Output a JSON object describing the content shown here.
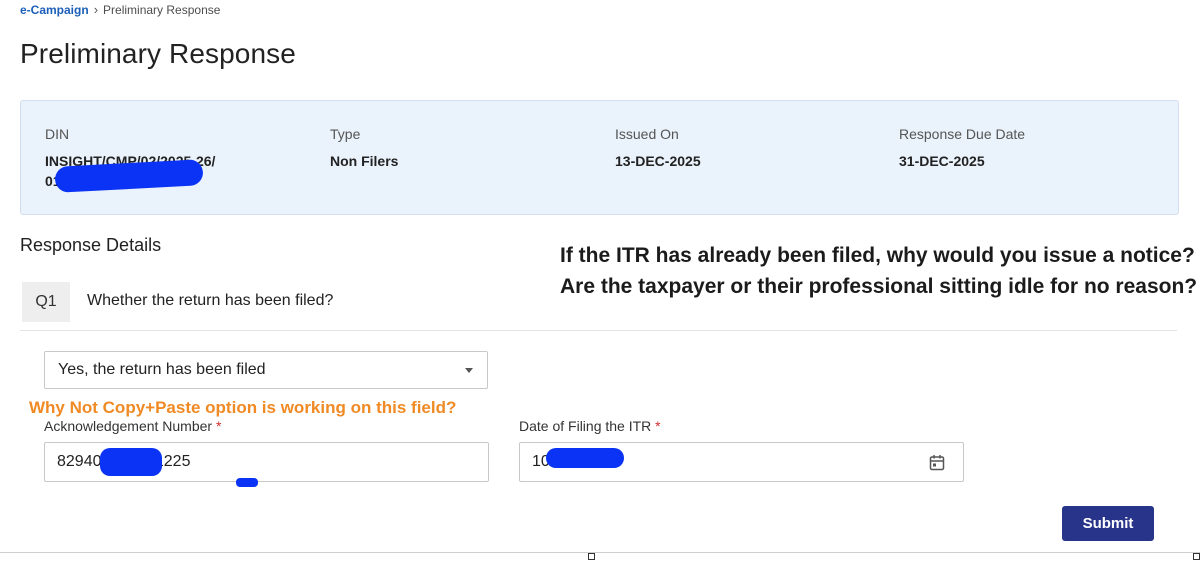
{
  "breadcrumb": {
    "parent": "e-Campaign",
    "current": "Preliminary Response"
  },
  "page_title": "Preliminary Response",
  "info": {
    "din": {
      "label": "DIN",
      "value": "INSIGHT/CMP/02/2025-26/01200001"
    },
    "type": {
      "label": "Type",
      "value": "Non Filers"
    },
    "issued_on": {
      "label": "Issued On",
      "value": "13-DEC-2025"
    },
    "due_date": {
      "label": "Response Due Date",
      "value": "31-DEC-2025"
    }
  },
  "section_title": "Response Details",
  "question": {
    "number": "Q1",
    "text": "Whether the return has been filed?"
  },
  "answer_select": {
    "value": "Yes, the return has been filed"
  },
  "annotation_text": "If the ITR has already been filed, why would you issue a notice? Are the taxpayer or their professional sitting idle for no reason?",
  "orange_note": "Why Not Copy+Paste option is working on this field?",
  "ack_field": {
    "label": "Acknowledgement Number",
    "required": "*",
    "value": "829400000001225"
  },
  "date_field": {
    "label": "Date of Filing the ITR",
    "required": "*",
    "value": "10"
  },
  "submit_label": "Submit",
  "colors": {
    "accent": "#28348a",
    "link": "#1b5fb8",
    "card_bg": "#eaf2fb",
    "annotation_orange": "#f08a24",
    "redaction": "#0a33f5"
  }
}
